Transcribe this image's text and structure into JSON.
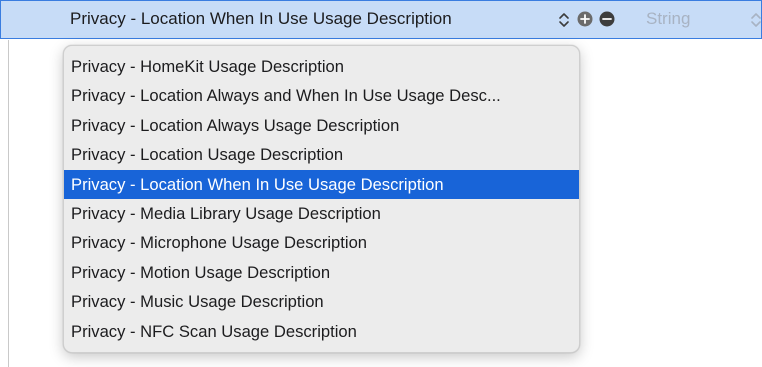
{
  "selected_row": {
    "key": "Privacy - Location When In Use Usage Description",
    "type": "String",
    "icons": [
      "stepper-icon",
      "add-icon",
      "remove-icon",
      "type-stepper-icon"
    ]
  },
  "menu": {
    "selected_index": 4,
    "items": [
      {
        "label": "Privacy - HomeKit Usage Description"
      },
      {
        "label": "Privacy - Location Always and When In Use Usage Desc..."
      },
      {
        "label": "Privacy - Location Always Usage Description"
      },
      {
        "label": "Privacy - Location Usage Description"
      },
      {
        "label": "Privacy - Location When In Use Usage Description"
      },
      {
        "label": "Privacy - Media Library Usage Description"
      },
      {
        "label": "Privacy - Microphone Usage Description"
      },
      {
        "label": "Privacy - Motion Usage Description"
      },
      {
        "label": "Privacy - Music Usage Description"
      },
      {
        "label": "Privacy - NFC Scan Usage Description"
      }
    ]
  },
  "colors": {
    "row_highlight": "#c7dcf7",
    "row_border": "#3a7de0",
    "menu_selection": "#1864d8",
    "menu_background": "#ececec"
  }
}
